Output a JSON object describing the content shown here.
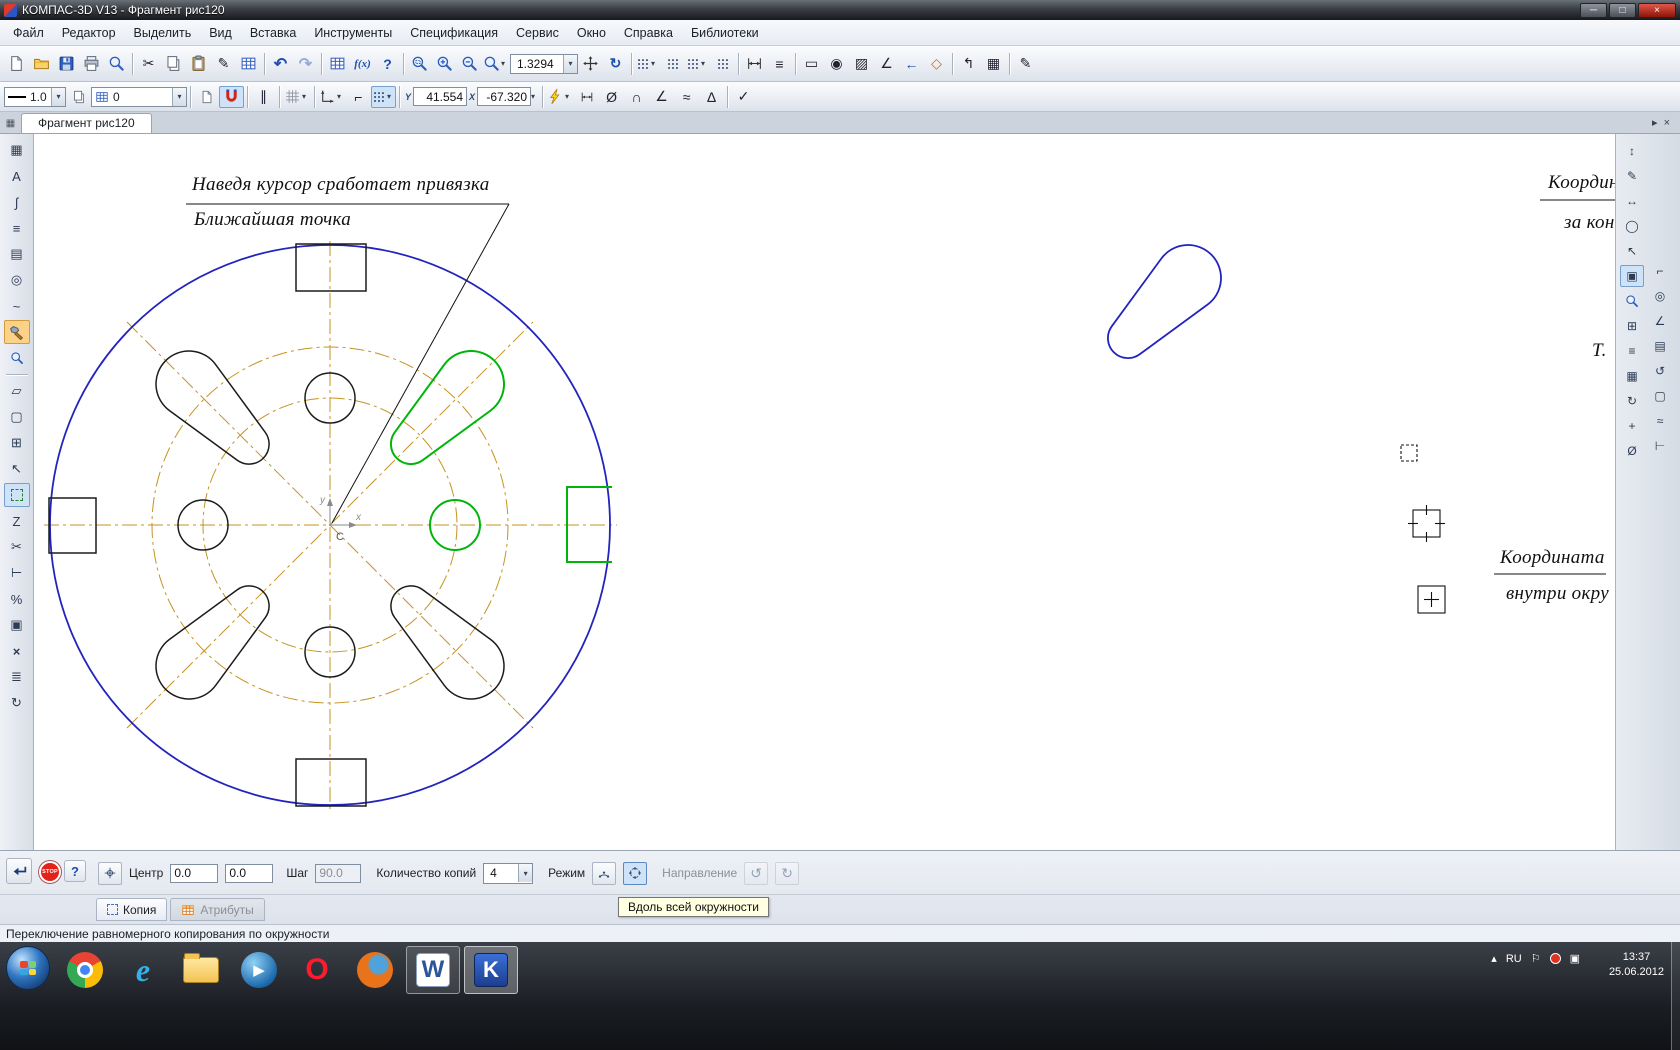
{
  "window": {
    "title": "КОМПАС-3D V13 - Фрагмент рис120",
    "controls": {
      "minimize": "─",
      "maximize": "□",
      "close": "×"
    }
  },
  "menu": [
    "Файл",
    "Редактор",
    "Выделить",
    "Вид",
    "Вставка",
    "Инструменты",
    "Спецификация",
    "Сервис",
    "Окно",
    "Справка",
    "Библиотеки"
  ],
  "toolbar_top": {
    "zoom_value": "1.3294"
  },
  "toolbar_current": {
    "line_style": "1.0",
    "layer": "0",
    "coord_y_label": "Y",
    "coord_x_label": "X",
    "coord_y": "41.554",
    "coord_x": "-67.320"
  },
  "tabbar": {
    "tab": "Фрагмент рис120"
  },
  "drawing": {
    "callout_line1": "Наведя курсор сработает привязка",
    "callout_line2": "Ближайшая точка",
    "axis_y_label": "y",
    "axis_x_label": "x",
    "snap_label": "С",
    "note_right_top1": "Координ",
    "note_right_top2": "за конт",
    "note_t": "Т.",
    "note_right_bottom1": "Координата",
    "note_right_bottom2": "внутри окру"
  },
  "property_bar": {
    "stop_label": "STOP",
    "center_label": "Центр",
    "center_x": "0.0",
    "center_y": "0.0",
    "step_label": "Шаг",
    "step_value": "90.0",
    "copies_label": "Количество копий",
    "copies_value": "4",
    "mode_label": "Режим",
    "direction_label": "Направление",
    "tab_copy": "Копия",
    "tab_attributes": "Атрибуты",
    "tooltip": "Вдоль всей окружности"
  },
  "status": {
    "message": "Переключение равномерного копирования по окружности"
  },
  "taskbar": {
    "language": "RU",
    "time": "13:37",
    "date": "25.06.2012",
    "ie_letter": "e",
    "media_play_glyph": "▶",
    "opera_letter": "O",
    "word_letter": "W",
    "kompas_letter": "K",
    "tray_expand": "▴",
    "flag": "⚐",
    "monitor": "▣"
  },
  "glyphs": {
    "dropdown": "▾",
    "cut": "✂",
    "style_brush": "✎",
    "undo": "↶",
    "redo": "↷",
    "fx": "f(x)",
    "help": "?",
    "refresh": "↻",
    "dim_list": "≡",
    "monitor": "▭",
    "target": "◉",
    "hatch": "▨",
    "angle": "∠",
    "arrow_left": "←",
    "diamond": "◇",
    "corner": "↰",
    "big_grid": "▦",
    "measure_pencil": "✎",
    "parallel": "∥",
    "ortho": "⌐",
    "diameter": "Ø",
    "arc": "∩",
    "wave": "≈",
    "chamfer": "∆",
    "roughness": "✓",
    "dir_ccw": "↺",
    "dir_cw": "↻",
    "tab_prev": "▸",
    "tab_close": "×",
    "panel_toggle": "▦"
  },
  "left_tools": [
    "▦",
    "A",
    "∫",
    "≡",
    "▤",
    "◎",
    "~",
    "▱",
    "▢",
    "⊞",
    "↖",
    "Z",
    "✂",
    "⊢",
    "%",
    "▣",
    "×",
    "≣",
    "↻"
  ],
  "right_tools_a": [
    "↕",
    "✎",
    "↔",
    "◯",
    "↖",
    "▣",
    "⊞",
    "≡",
    "▦",
    "↻",
    "+",
    "Ø"
  ],
  "right_tools_b": [
    "⌐",
    "◎",
    "∠",
    "▤",
    "↺",
    "▢",
    "≈",
    "⊢"
  ]
}
